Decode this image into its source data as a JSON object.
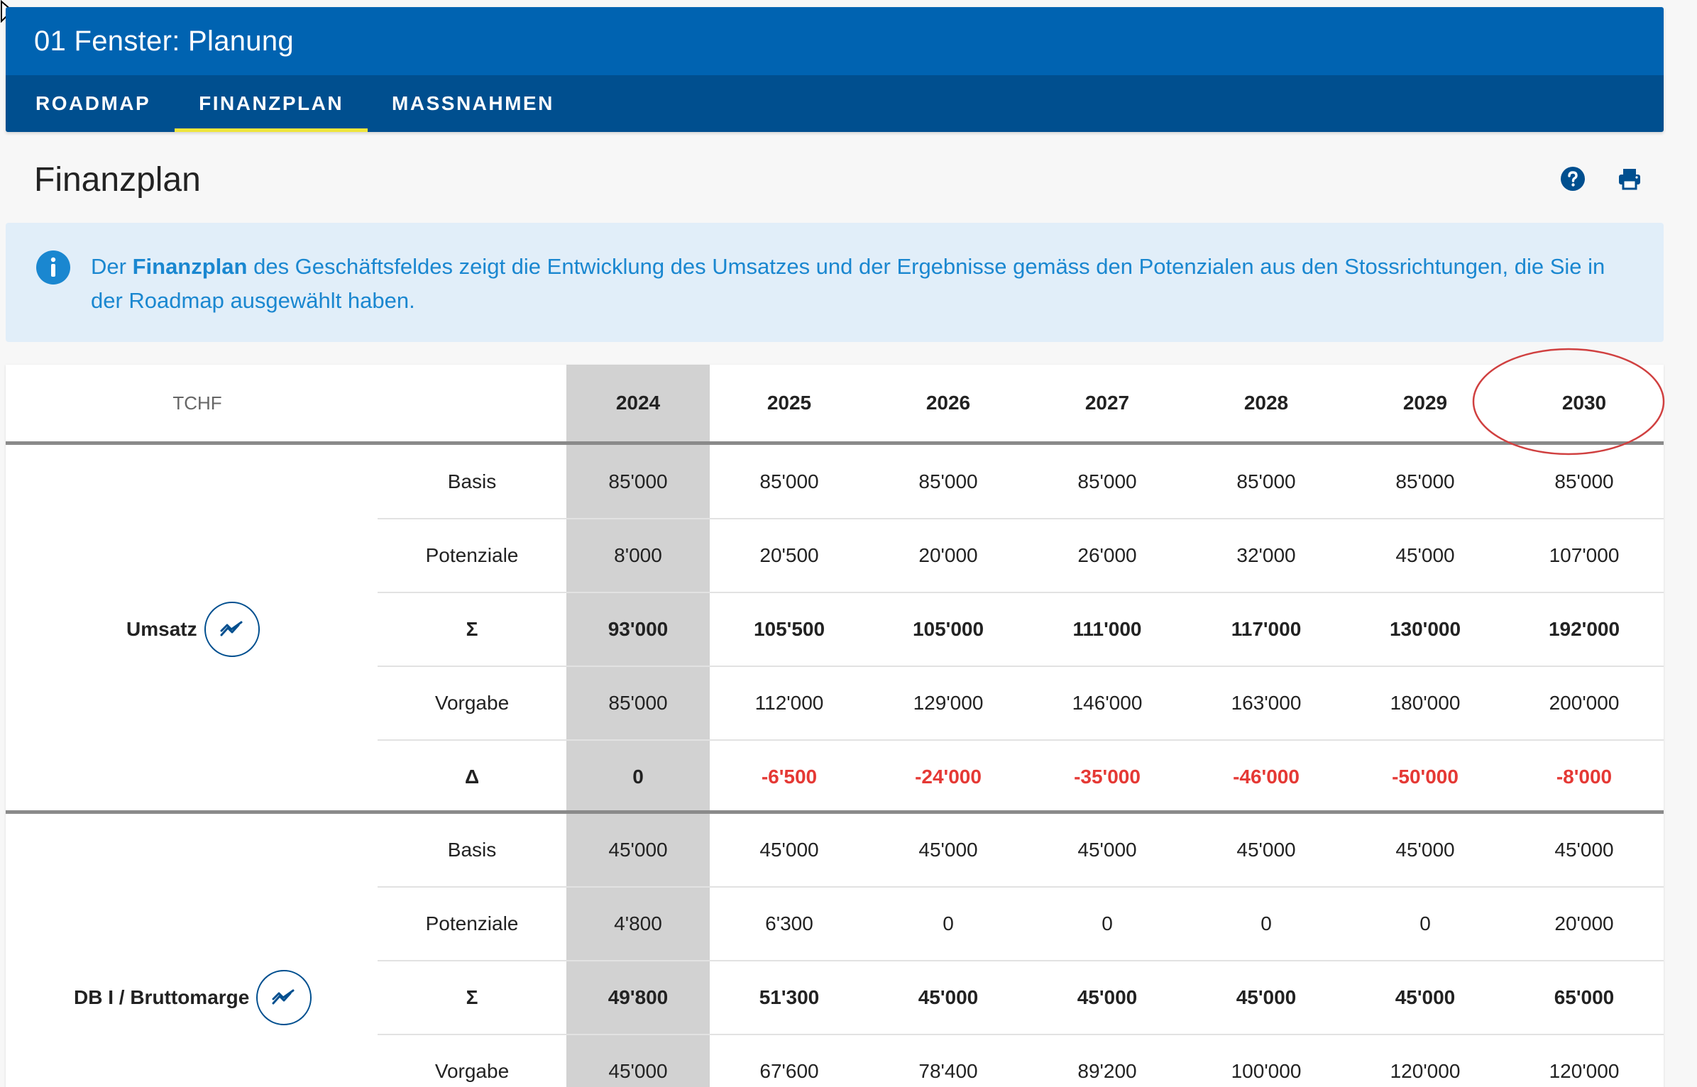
{
  "header": {
    "title": "01 Fenster: Planung",
    "tabs": [
      {
        "label": "ROADMAP"
      },
      {
        "label": "FINANZPLAN"
      },
      {
        "label": "MASSNAHMEN"
      }
    ],
    "active_tab": "FINANZPLAN"
  },
  "page": {
    "title": "Finanzplan",
    "help_icon": "help-circle-icon",
    "print_icon": "printer-icon"
  },
  "info": {
    "icon": "info-circle-icon",
    "text_before": "Der ",
    "text_bold": "Finanzplan",
    "text_after": " des Geschäftsfeldes zeigt die Entwicklung des Umsatzes und der Ergebnisse gemäss den Potenzialen aus den Stossrichtungen, die Sie in der Roadmap ausgewählt haben."
  },
  "table": {
    "unit": "TCHF",
    "years": [
      "2024",
      "2025",
      "2026",
      "2027",
      "2028",
      "2029",
      "2030"
    ],
    "groups": [
      {
        "label": "Umsatz",
        "rows": [
          {
            "label": "Basis",
            "values": [
              "85'000",
              "85'000",
              "85'000",
              "85'000",
              "85'000",
              "85'000",
              "85'000"
            ]
          },
          {
            "label": "Potenziale",
            "values": [
              "8'000",
              "20'500",
              "20'000",
              "26'000",
              "32'000",
              "45'000",
              "107'000"
            ]
          },
          {
            "label": "Σ",
            "values": [
              "93'000",
              "105'500",
              "105'000",
              "111'000",
              "117'000",
              "130'000",
              "192'000"
            ]
          },
          {
            "label": "Vorgabe",
            "values": [
              "85'000",
              "112'000",
              "129'000",
              "146'000",
              "163'000",
              "180'000",
              "200'000"
            ]
          },
          {
            "label": "Δ",
            "values": [
              "0",
              "-6'500",
              "-24'000",
              "-35'000",
              "-46'000",
              "-50'000",
              "-8'000"
            ]
          }
        ]
      },
      {
        "label": "DB I / Bruttomarge",
        "rows": [
          {
            "label": "Basis",
            "values": [
              "45'000",
              "45'000",
              "45'000",
              "45'000",
              "45'000",
              "45'000",
              "45'000"
            ]
          },
          {
            "label": "Potenziale",
            "values": [
              "4'800",
              "6'300",
              "0",
              "0",
              "0",
              "0",
              "20'000"
            ]
          },
          {
            "label": "Σ",
            "values": [
              "49'800",
              "51'300",
              "45'000",
              "45'000",
              "45'000",
              "45'000",
              "65'000"
            ]
          },
          {
            "label": "Vorgabe",
            "values": [
              "45'000",
              "67'600",
              "78'400",
              "89'200",
              "100'000",
              "120'000",
              "120'000"
            ]
          }
        ]
      }
    ]
  },
  "colors": {
    "title_bar": "#0063b1",
    "tab_bar": "#004f8f",
    "tab_indicator": "#f0e63a",
    "info_bg": "#e1eef9",
    "info_text": "#1a87d0",
    "negative": "#e53935",
    "highlight_year_bg": "#d2d2d2",
    "annotation": "#d04040"
  }
}
